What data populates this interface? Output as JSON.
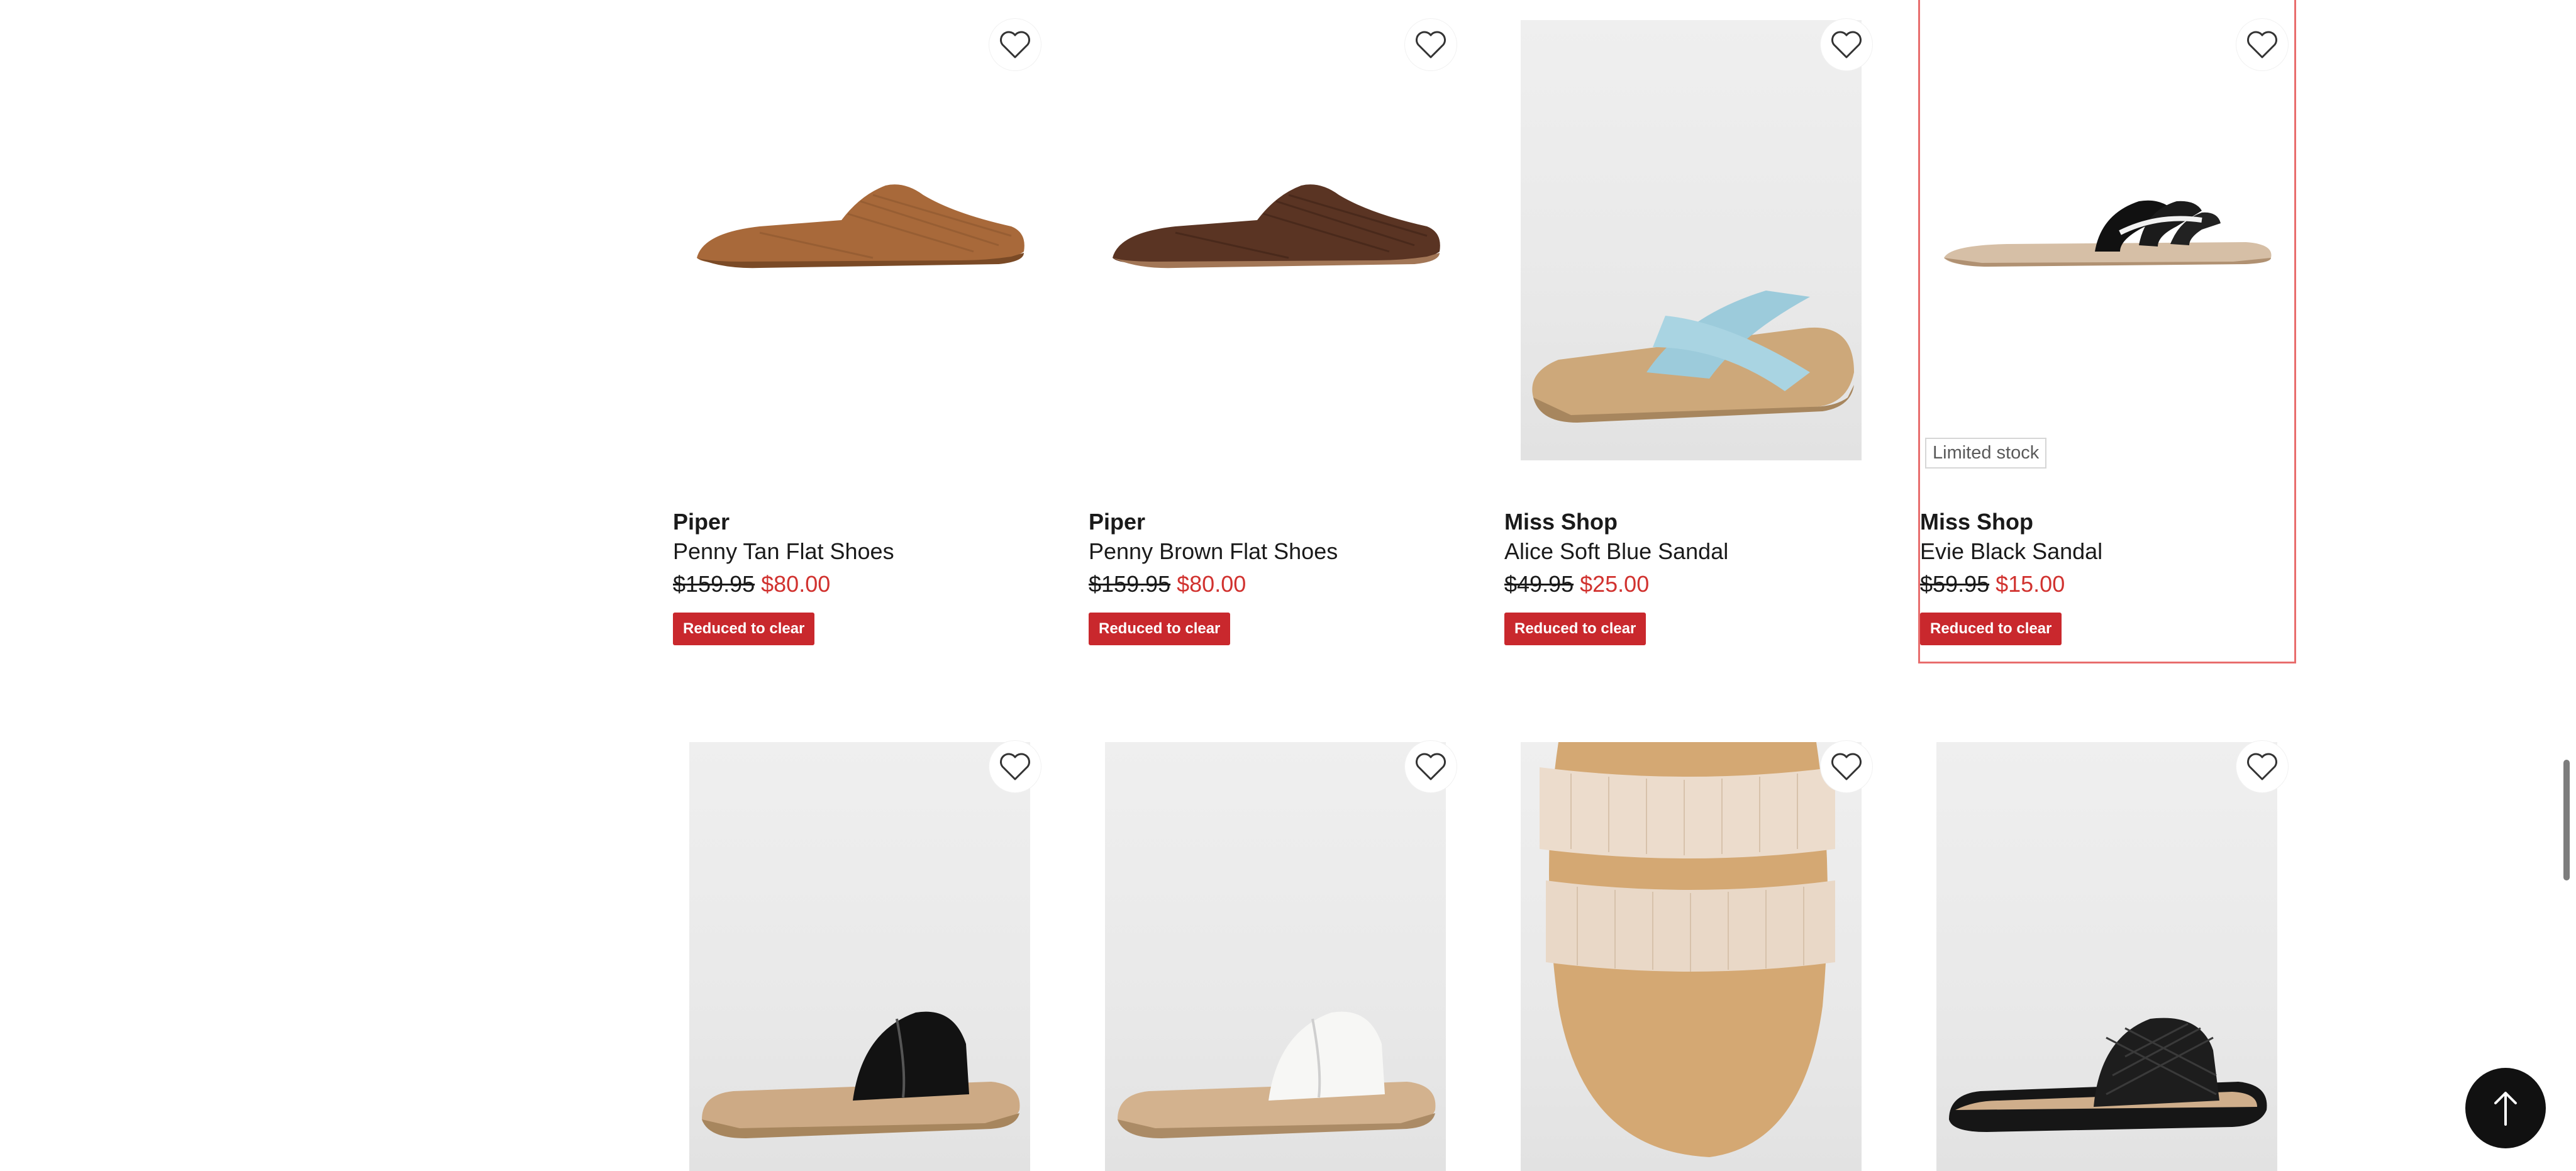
{
  "colors": {
    "accent_red": "#c9282d",
    "sale_price": "#d1322f",
    "selected_outline": "#e86d6d"
  },
  "products": [
    {
      "brand": "Piper",
      "name": "Penny Tan Flat Shoes",
      "was_price": "$159.95",
      "now_price": "$80.00",
      "badge": "Reduced to clear",
      "stock": ""
    },
    {
      "brand": "Piper",
      "name": "Penny Brown Flat Shoes",
      "was_price": "$159.95",
      "now_price": "$80.00",
      "badge": "Reduced to clear",
      "stock": ""
    },
    {
      "brand": "Miss Shop",
      "name": "Alice Soft Blue Sandal",
      "was_price": "$49.95",
      "now_price": "$25.00",
      "badge": "Reduced to clear",
      "stock": ""
    },
    {
      "brand": "Miss Shop",
      "name": "Evie Black Sandal",
      "was_price": "$59.95",
      "now_price": "$15.00",
      "badge": "Reduced to clear",
      "stock": "Limited stock"
    }
  ],
  "icons": {
    "favourite": "heart-outline-icon",
    "back_to_top": "arrow-up-icon"
  }
}
